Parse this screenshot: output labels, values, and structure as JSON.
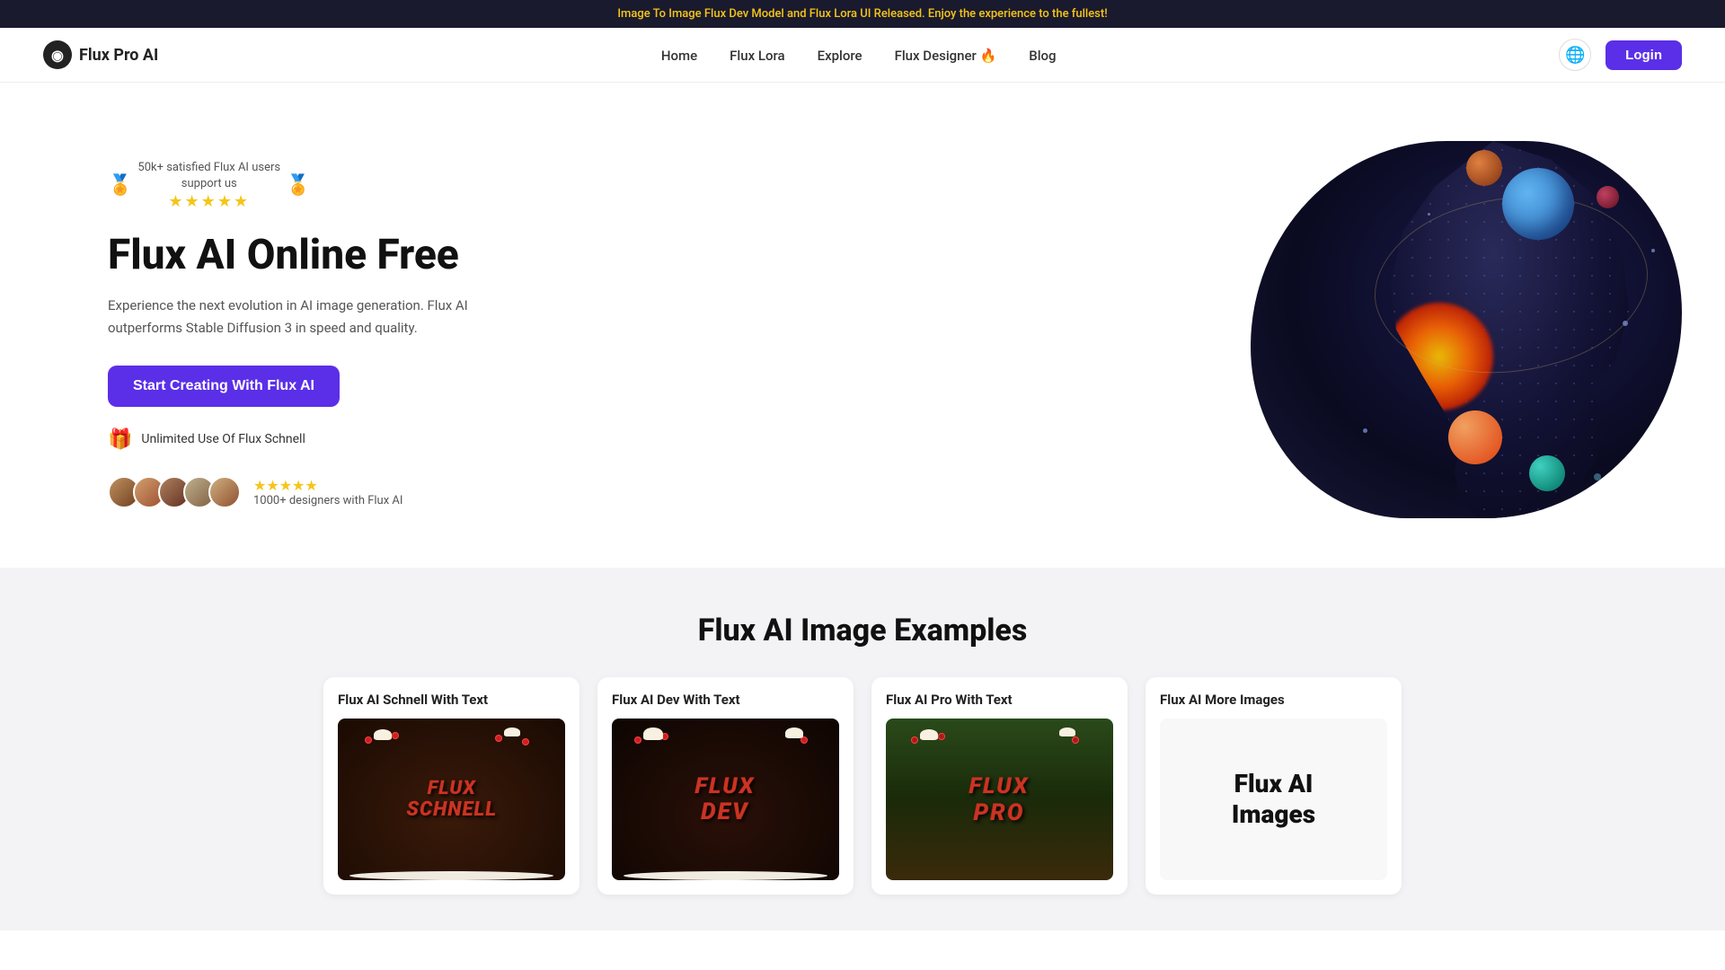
{
  "banner": {
    "text": "Image To Image Flux Dev Model and Flux Lora UI Released. Enjoy the experience to the fullest!"
  },
  "nav": {
    "logo_text": "Flux Pro AI",
    "links": [
      {
        "label": "Home",
        "id": "home"
      },
      {
        "label": "Flux Lora",
        "id": "flux-lora"
      },
      {
        "label": "Explore",
        "id": "explore"
      },
      {
        "label": "Flux Designer 🔥",
        "id": "flux-designer"
      },
      {
        "label": "Blog",
        "id": "blog"
      }
    ],
    "login_label": "Login"
  },
  "hero": {
    "badge_users": "50k+ satisfied Flux AI users",
    "badge_support": "support us",
    "stars": "★★★★★",
    "title": "Flux AI Online Free",
    "description": "Experience the next evolution in AI image generation. Flux AI outperforms Stable Diffusion 3 in speed and quality.",
    "cta_label": "Start Creating With Flux AI",
    "unlimited_label": "Unlimited Use Of Flux Schnell",
    "proof_stars": "★★★★★",
    "proof_count": "1000+ designers with Flux AI"
  },
  "examples": {
    "section_title": "Flux AI Image Examples",
    "cards": [
      {
        "id": "schnell",
        "title": "Flux AI Schnell With Text",
        "cake_text_line1": "FLUX",
        "cake_text_line2": "SCHNELL"
      },
      {
        "id": "dev",
        "title": "Flux AI Dev With Text",
        "cake_text_line1": "FLUX",
        "cake_text_line2": "DEV"
      },
      {
        "id": "pro",
        "title": "Flux AI Pro With Text",
        "cake_text_line1": "FLUX",
        "cake_text_line2": "PRO"
      },
      {
        "id": "more",
        "title": "Flux AI More Images",
        "more_text_line1": "Flux AI",
        "more_text_line2": "Images"
      }
    ]
  }
}
